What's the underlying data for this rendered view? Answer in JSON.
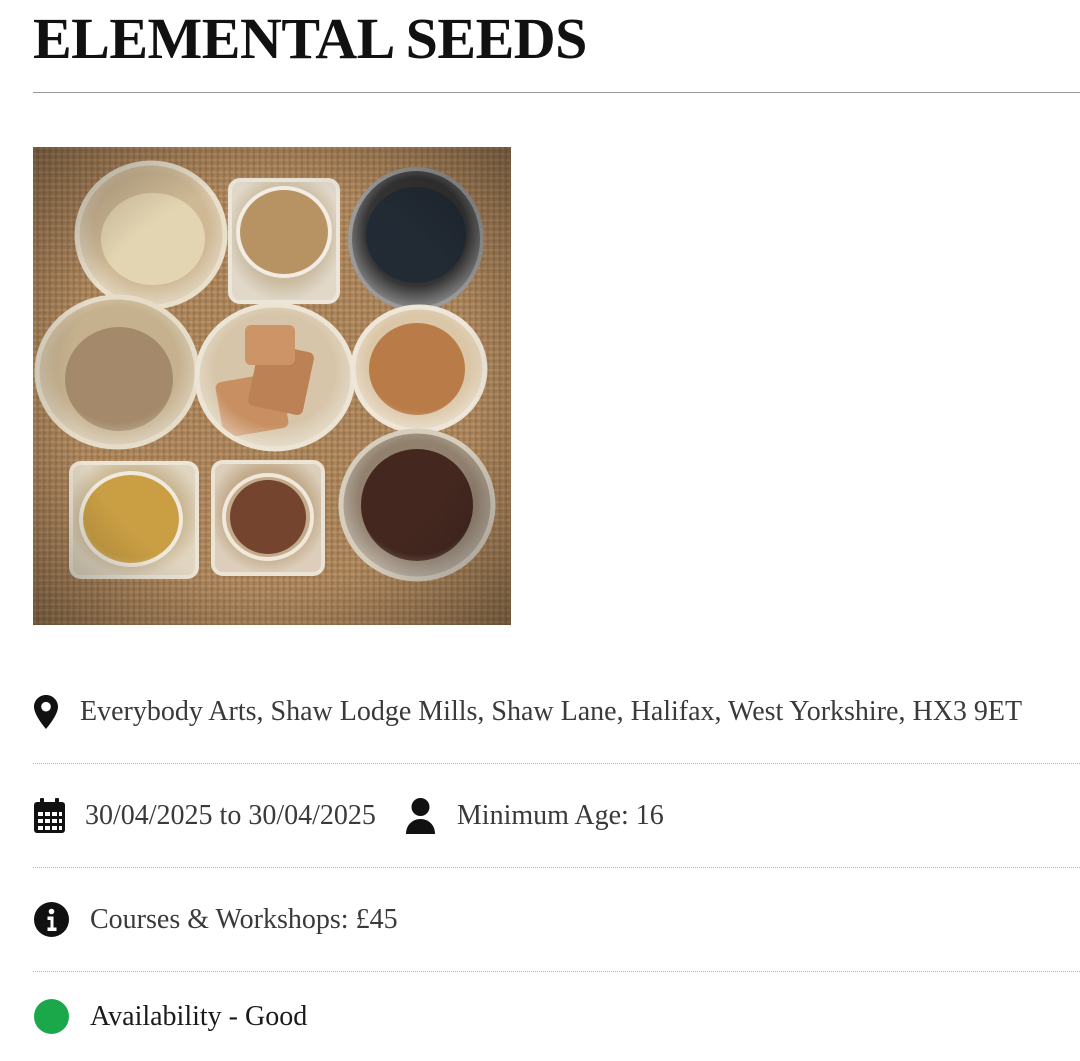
{
  "event": {
    "title": "ELEMENTAL SEEDS",
    "image_alt": "Glass jars filled with various natural pigments and dyes on hessian cloth"
  },
  "details": {
    "location": {
      "icon": "map-pin-icon",
      "text": "Everybody Arts, Shaw Lodge Mills, Shaw Lane, Halifax, West Yorkshire, HX3 9ET"
    },
    "dates": {
      "icon": "calendar-icon",
      "text": "30/04/2025 to 30/04/2025"
    },
    "age": {
      "icon": "user-icon",
      "text": "Minimum Age: 16"
    },
    "price": {
      "icon": "info-circle-icon",
      "text": "Courses & Workshops: £45"
    },
    "availability": {
      "icon": "status-dot-icon",
      "text": "Availability - Good",
      "color": "#1aa84a"
    }
  },
  "colors": {
    "title": "#111111",
    "text": "#3a3a3a",
    "icon": "#111111",
    "availability_good": "#1aa84a",
    "burlap": "#a9825a"
  }
}
